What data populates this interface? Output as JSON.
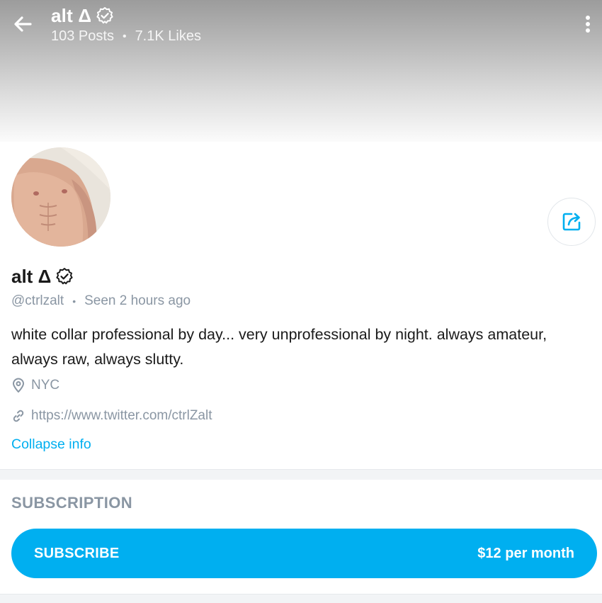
{
  "header": {
    "name": "alt Δ",
    "posts": "103 Posts",
    "separator": "•",
    "likes": "7.1K Likes"
  },
  "profile": {
    "name": "alt Δ",
    "handle": "@ctrlzalt",
    "separator": "•",
    "last_seen": "Seen 2 hours ago",
    "bio": "white collar professional by day... very unprofessional by night. always amateur, always raw, always slutty.",
    "location": "NYC",
    "link": "https://www.twitter.com/ctrlZalt",
    "collapse_label": "Collapse info"
  },
  "subscription": {
    "section_title": "SUBSCRIPTION",
    "button_label": "SUBSCRIBE",
    "price": "$12 per month"
  },
  "icons": {
    "back": "arrow-left-icon",
    "more": "more-vertical-icon",
    "verified": "verified-badge-icon",
    "share": "share-icon",
    "location": "map-pin-icon",
    "link": "link-icon"
  },
  "colors": {
    "accent": "#00aff0",
    "muted_text": "#8a96a3",
    "primary_text": "#1a1a1a",
    "button_text": "#ffffff"
  }
}
